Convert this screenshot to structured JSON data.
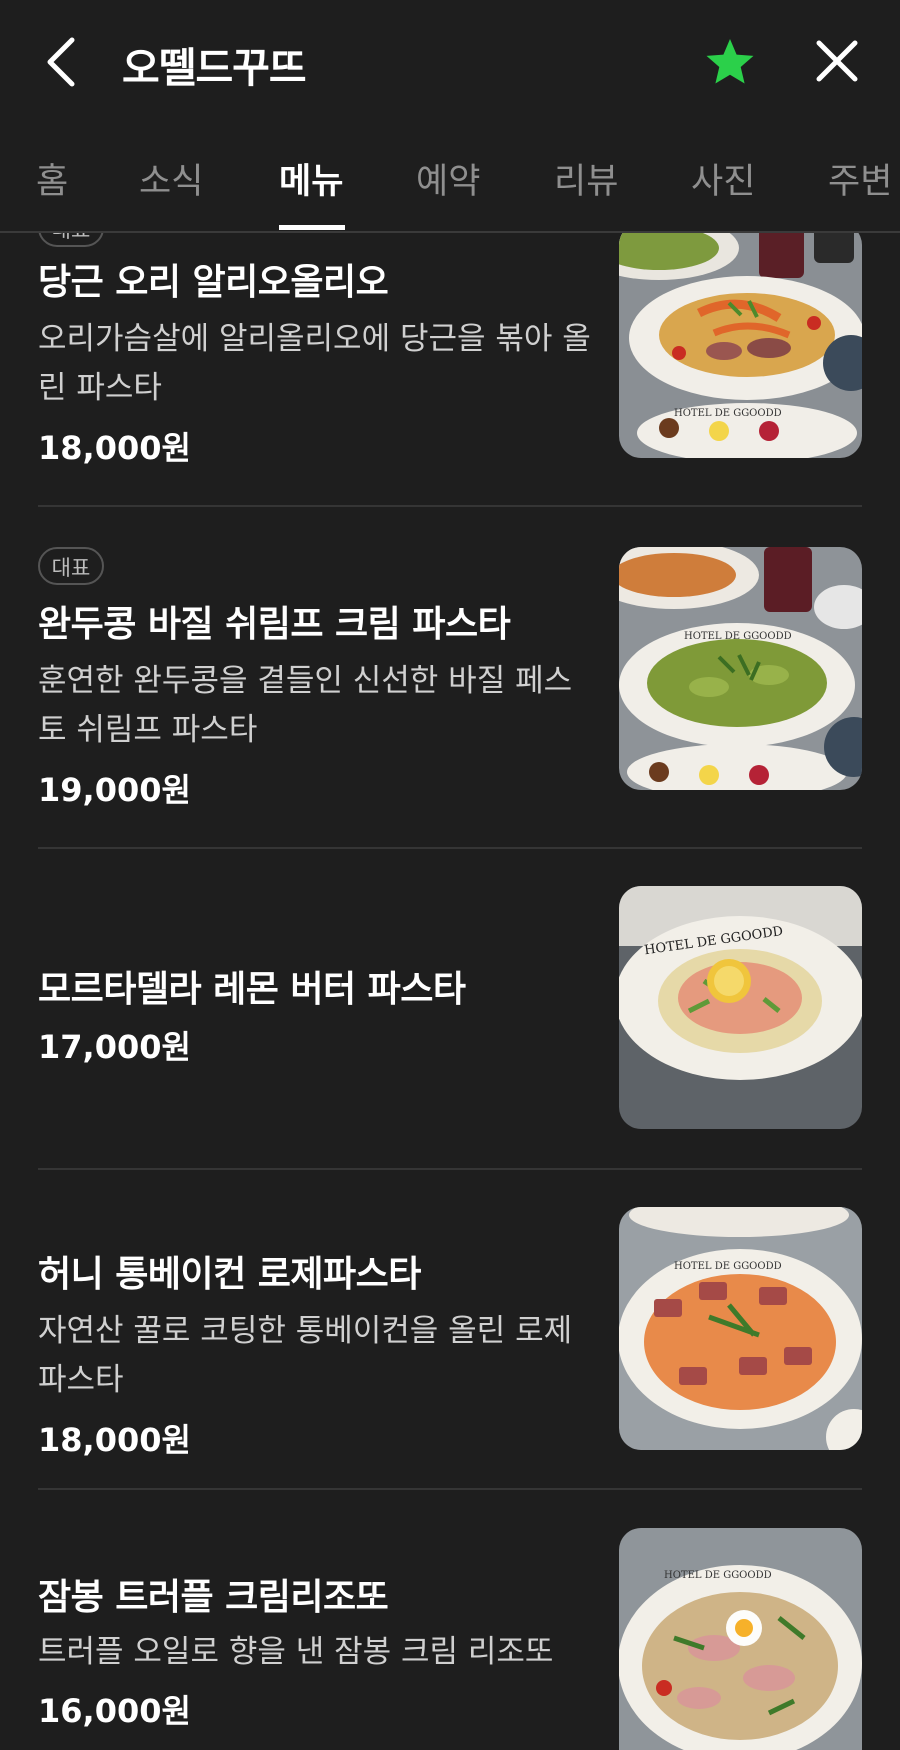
{
  "header": {
    "title": "오뗄드꾸뜨",
    "favorite_color": "#2bd04a"
  },
  "tabs": [
    {
      "label": "홈"
    },
    {
      "label": "소식"
    },
    {
      "label": "메뉴",
      "active": true
    },
    {
      "label": "예약"
    },
    {
      "label": "리뷰"
    },
    {
      "label": "사진"
    },
    {
      "label": "주변"
    }
  ],
  "menu": [
    {
      "badge": "",
      "name": "당근 오리 알리오올리오",
      "desc": "오리가슴살에 알리올리오에 당근을 볶아 올린 파스타",
      "price": "18,000원",
      "photo_text": "HOTEL DE GGOODD"
    },
    {
      "badge": "대표",
      "name": "완두콩 바질 쉬림프 크림 파스타",
      "desc": "훈연한 완두콩을 곁들인 신선한 바질 페스토 쉬림프 파스타",
      "price": "19,000원",
      "photo_text": "HOTEL DE GGOODD"
    },
    {
      "badge": "",
      "name": "모르타델라 레몬 버터 파스타",
      "desc": "",
      "price": "17,000원",
      "photo_text": "HOTEL DE GGOODD"
    },
    {
      "badge": "",
      "name": "허니 통베이컨 로제파스타",
      "desc": "자연산 꿀로 코팅한 통베이컨을 올린 로제파스타",
      "price": "18,000원",
      "photo_text": "HOTEL DE GGOODD"
    },
    {
      "badge": "",
      "name": "잠봉 트러플 크림리조또",
      "desc": "트러플 오일로 향을 낸 잠봉 크림 리조또",
      "price": "16,000원",
      "photo_text": "HOTEL DE GGOODD"
    }
  ]
}
